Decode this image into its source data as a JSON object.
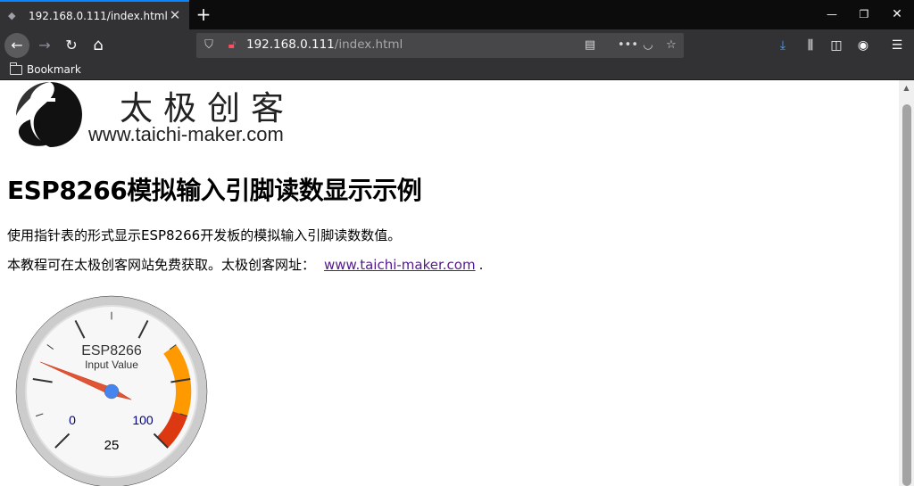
{
  "browser": {
    "tab_title": "192.168.0.111/index.html",
    "tab_close_glyph": "✕",
    "new_tab_glyph": "+",
    "window_min_glyph": "—",
    "window_restore_glyph": "❐",
    "window_close_glyph": "✕",
    "back_glyph": "←",
    "forward_glyph": "→",
    "reload_glyph": "↻",
    "home_glyph": "⌂",
    "url_host": "192.168.0.111",
    "url_path": "/index.html",
    "bookmark_label": "Bookmark",
    "accent_color": "#0a84ff"
  },
  "page": {
    "logo_cn": "太极创客",
    "logo_en": "www.taichi-maker.com",
    "title": "ESP8266模拟输入引脚读数显示示例",
    "para1": "使用指针表的形式显示ESP8266开发板的模拟输入引脚读数数值。",
    "para2_prefix": "本教程可在太极创客网站免费获取。太极创客网址：",
    "para2_link": "www.taichi-maker.com",
    "para2_suffix": "."
  },
  "gauge": {
    "title": "ESP8266",
    "subtitle": "Input Value",
    "min_label": "0",
    "max_label": "100",
    "value": 25,
    "value_label": "25",
    "min": 0,
    "max": 100,
    "bands": [
      {
        "from": 70,
        "to": 90,
        "color": "#ff9900"
      },
      {
        "from": 90,
        "to": 100,
        "color": "#dc3912"
      }
    ],
    "needle_color": "#dc3912",
    "hub_color": "#4684ee"
  }
}
